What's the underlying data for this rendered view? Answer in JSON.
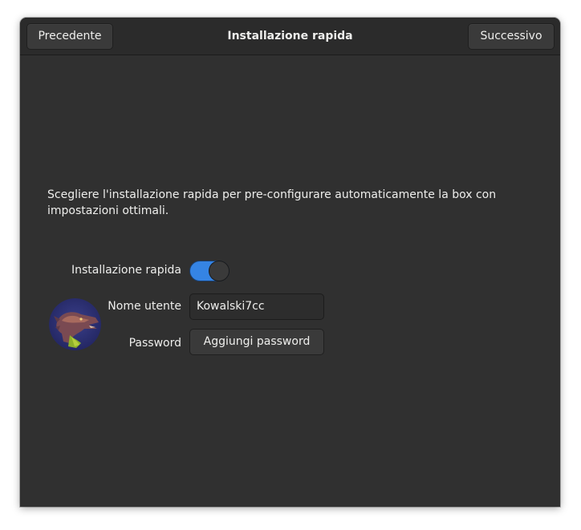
{
  "header": {
    "title": "Installazione rapida",
    "prev_label": "Precedente",
    "next_label": "Successivo"
  },
  "main": {
    "description": "Scegliere l'installazione rapida per pre-configurare automaticamente la box con impostazioni ottimali.",
    "quick_install": {
      "label": "Installazione rapida",
      "enabled": true
    },
    "username": {
      "label": "Nome utente",
      "value": "Kowalski7cc"
    },
    "password": {
      "label": "Password",
      "button_label": "Aggiungi password"
    },
    "avatar": {
      "icon": "dragon-avatar"
    }
  },
  "colors": {
    "window_bg": "#303030",
    "accent": "#3584e4"
  }
}
